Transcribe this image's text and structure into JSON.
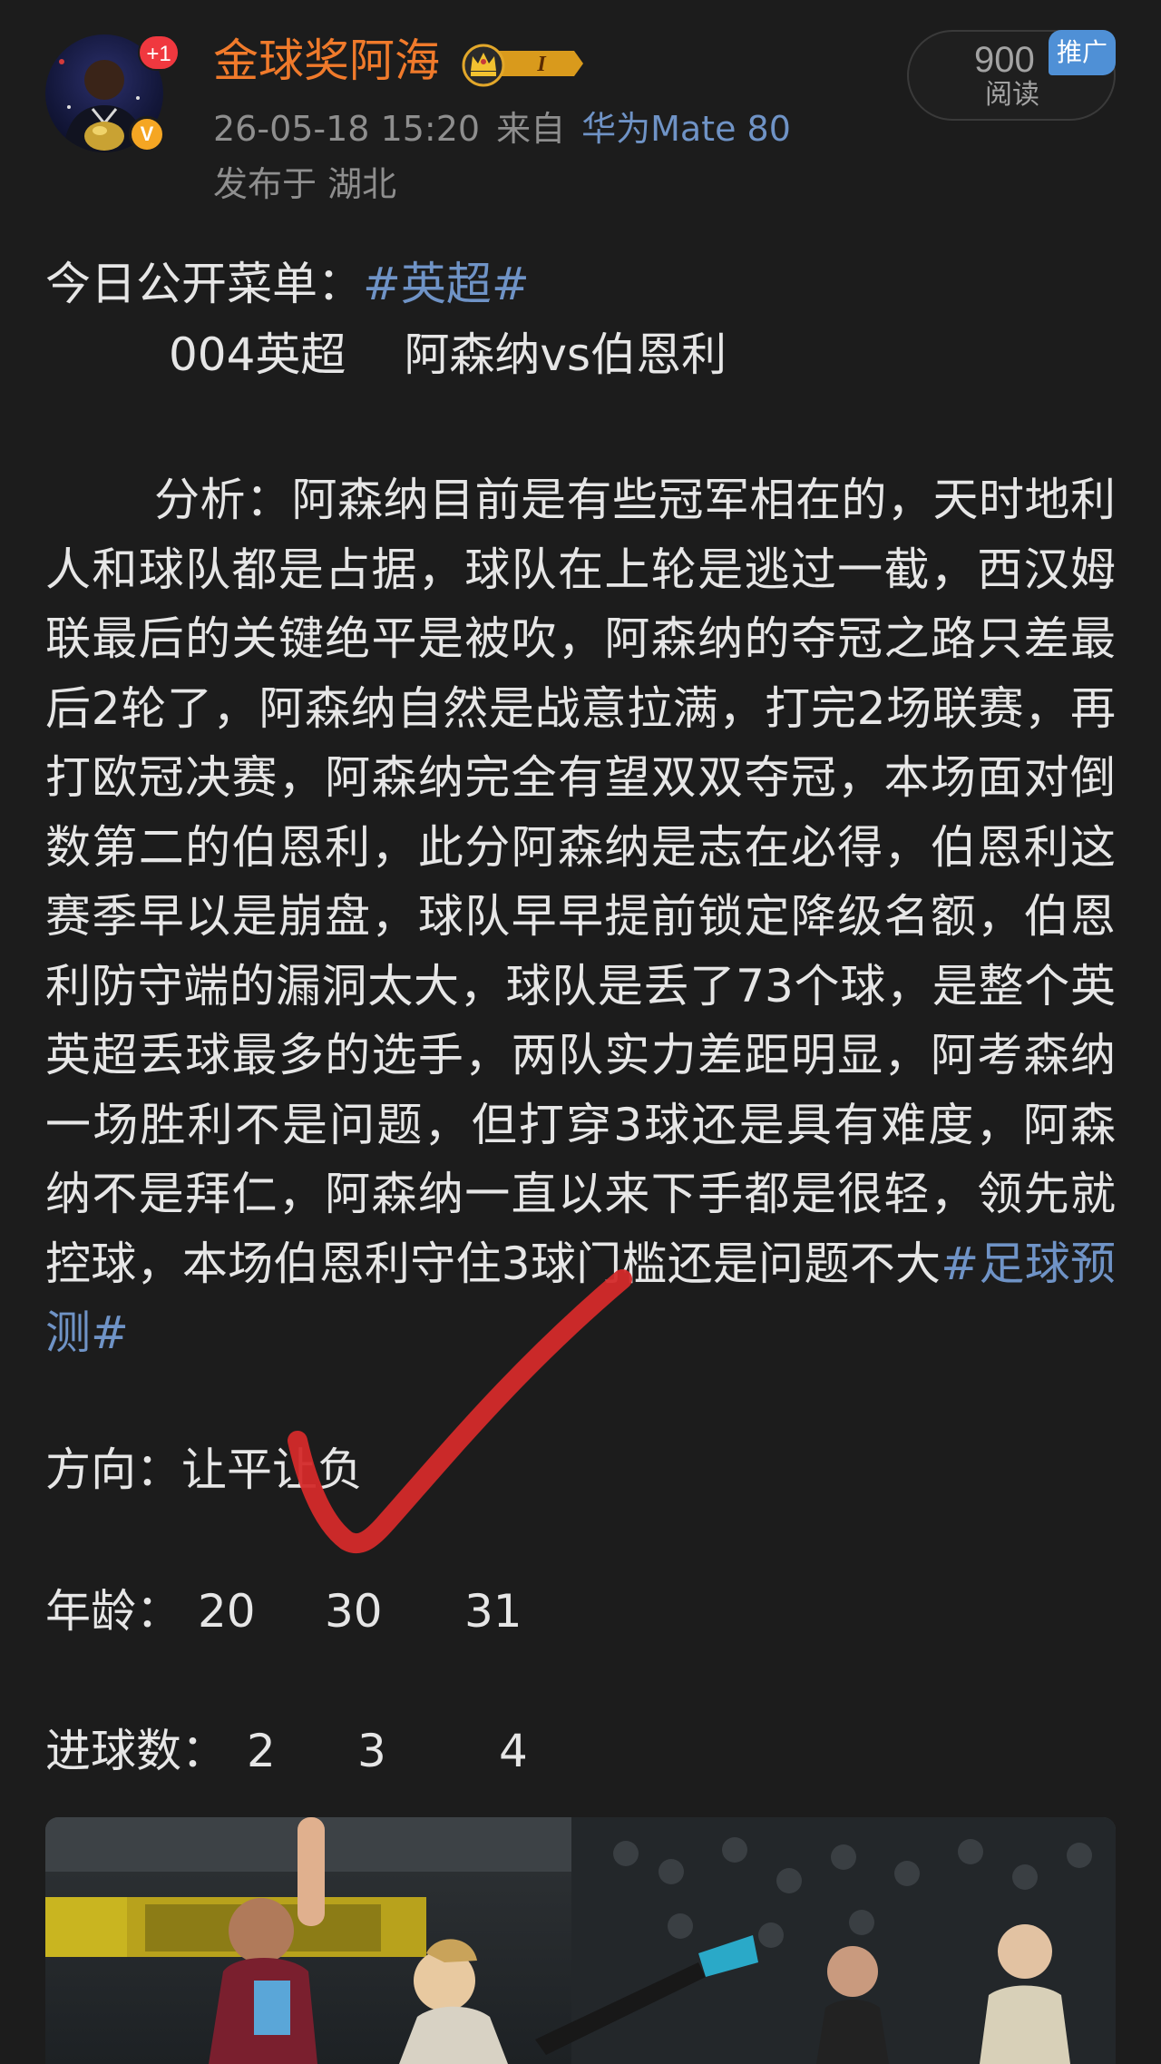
{
  "author": {
    "name": "金球奖阿海",
    "notification_count": "+1",
    "verified_mark": "V",
    "level_label": "I",
    "avatar_icon": "user-avatar-icon",
    "crown_icon": "crown-icon"
  },
  "post_meta": {
    "date": "26-05-18 15:20",
    "source_prefix": "来自",
    "device": "华为Mate 80",
    "location": "发布于 湖北"
  },
  "stats": {
    "views": "900",
    "views_label": "阅读",
    "promo_tag": "推广"
  },
  "content": {
    "menu_prefix": "今日公开菜单：",
    "menu_hashtag": "#英超#",
    "match_code": "004英超",
    "match_name": "阿森纳vs伯恩利",
    "analysis_text": "分析：阿森纳目前是有些冠军相在的，天时地利人和球队都是占据，球队在上轮是逃过一截，西汉姆联最后的关键绝平是被吹，阿森纳的夺冠之路只差最后2轮了，阿森纳自然是战意拉满，打完2场联赛，再打欧冠决赛，阿森纳完全有望双双夺冠，本场面对倒数第二的伯恩利，此分阿森纳是志在必得，伯恩利这赛季早以是崩盘，球队早早提前锁定降级名额，伯恩利防守端的漏洞太大，球队是丢了73个球，是整个英英超丢球最多的选手，两队实力差距明显，阿考森纳一场胜利不是问题，但打穿3球还是具有难度，阿森纳不是拜仁，阿森纳一直以来下手都是很轻，领先就控球，本场伯恩利守住3球门槛还是问题不大",
    "analysis_hashtag": "#足球预测#",
    "direction_label": "方向：",
    "direction_value": "让平让负",
    "age_label": "年龄：",
    "age_values": [
      "20",
      "30",
      "31"
    ],
    "goals_label": "进球数：",
    "goals_values": [
      "2",
      "3",
      "4"
    ]
  },
  "colors": {
    "background": "#1c1c1c",
    "username": "#f07a2b",
    "hashtag": "#6f93c6",
    "text": "#e6e6e6",
    "meta": "#8e8e8e",
    "promo": "#4f90d6",
    "checkmark": "#d42a2a"
  }
}
